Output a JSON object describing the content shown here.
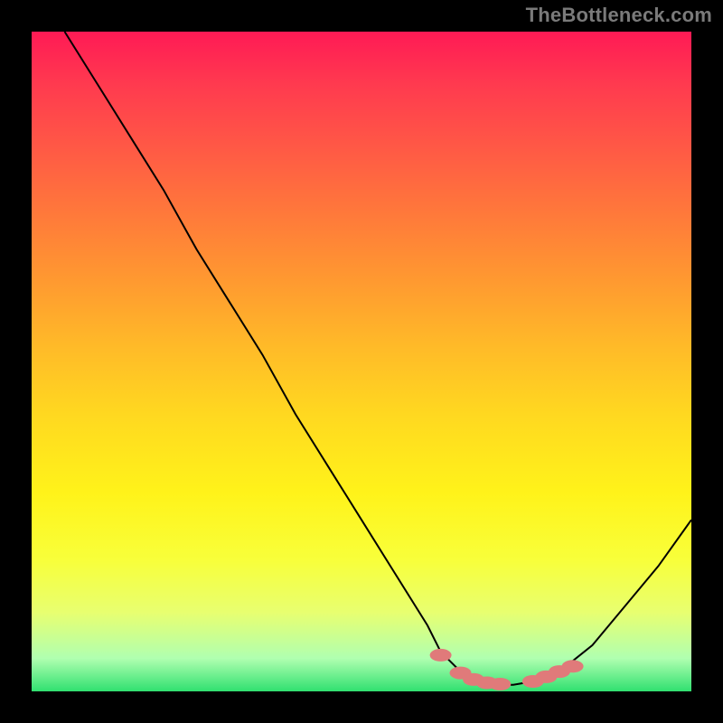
{
  "attribution": "TheBottleneck.com",
  "chart_data": {
    "type": "line",
    "title": "",
    "xlabel": "",
    "ylabel": "",
    "xlim": [
      0,
      100
    ],
    "ylim": [
      0,
      100
    ],
    "series": [
      {
        "name": "curve",
        "x": [
          5,
          10,
          15,
          20,
          25,
          30,
          35,
          40,
          45,
          50,
          55,
          60,
          62,
          65,
          68,
          70,
          73,
          76,
          80,
          85,
          90,
          95,
          100
        ],
        "y": [
          100,
          92,
          84,
          76,
          67,
          59,
          51,
          42,
          34,
          26,
          18,
          10,
          6,
          3,
          1.5,
          1,
          1,
          1.5,
          3,
          7,
          13,
          19,
          26
        ]
      }
    ],
    "markers": [
      {
        "x": 62,
        "y": 5.5
      },
      {
        "x": 65,
        "y": 2.8
      },
      {
        "x": 67,
        "y": 1.8
      },
      {
        "x": 69,
        "y": 1.3
      },
      {
        "x": 71,
        "y": 1.1
      },
      {
        "x": 76,
        "y": 1.5
      },
      {
        "x": 78,
        "y": 2.2
      },
      {
        "x": 80,
        "y": 3.0
      },
      {
        "x": 82,
        "y": 3.8
      }
    ],
    "gradient_stops": [
      {
        "pos": 0,
        "color": "#ff1a55"
      },
      {
        "pos": 0.5,
        "color": "#ffd820"
      },
      {
        "pos": 0.95,
        "color": "#b0ffb0"
      },
      {
        "pos": 1.0,
        "color": "#30e070"
      }
    ]
  }
}
